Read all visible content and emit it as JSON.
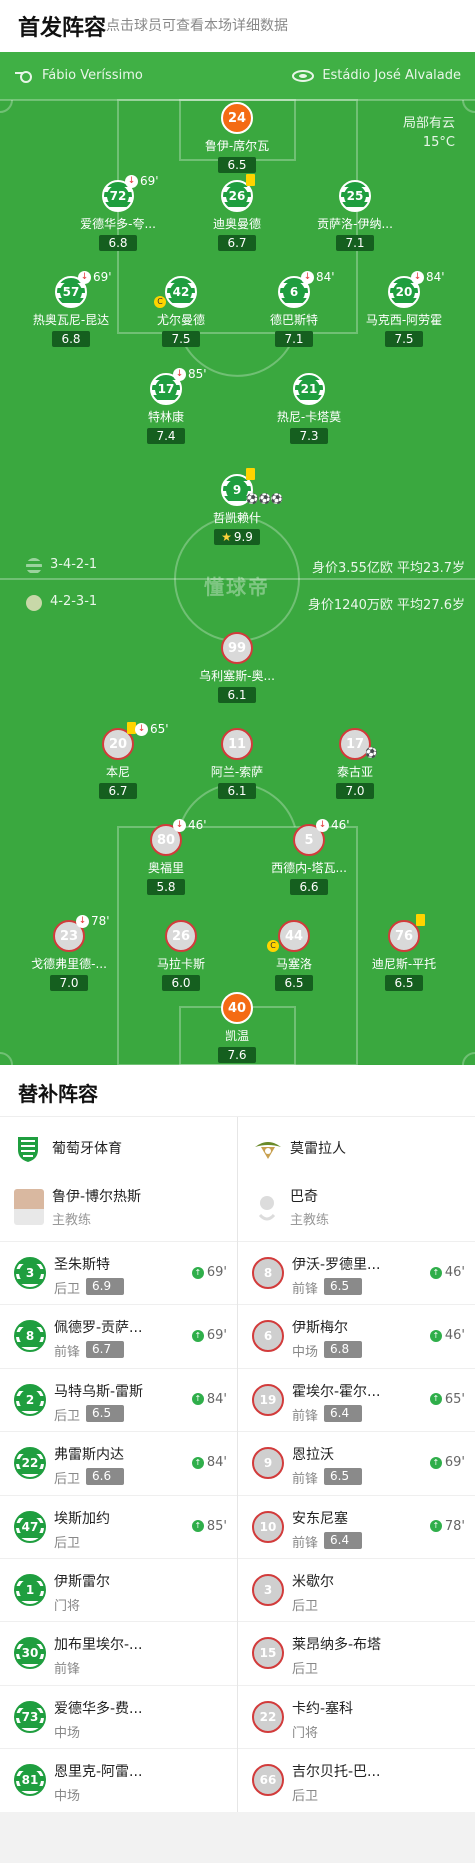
{
  "header": {
    "title": "首发阵容",
    "subtitle": "点击球员可查看本场详细数据"
  },
  "match": {
    "referee": "Fábio Veríssimo",
    "stadium": "Estádio José Alvalade",
    "weather": "局部有云",
    "temperature": "15°C"
  },
  "home_team": {
    "formation": "3-4-2-1",
    "value_avg": "身价3.55亿欧  平均23.7岁",
    "club": "葡萄牙体育",
    "coach_name": "鲁伊-博尔热斯",
    "coach_role": "主教练"
  },
  "away_team": {
    "formation": "4-2-3-1",
    "value_avg": "身价1240万欧  平均27.6岁",
    "club": "莫雷拉人",
    "coach_name": "巴奇",
    "coach_role": "主教练"
  },
  "watermark": "懂球帝",
  "home_players": [
    {
      "num": "24",
      "name": "鲁伊-席尔瓦",
      "rating": "6.5",
      "gk": true
    },
    {
      "num": "72",
      "name": "爱德华多-夸...",
      "rating": "6.8",
      "sub": "69'"
    },
    {
      "num": "26",
      "name": "迪奥曼德",
      "rating": "6.7",
      "yellow": true
    },
    {
      "num": "25",
      "name": "贡萨洛-伊纳...",
      "rating": "7.1"
    },
    {
      "num": "57",
      "name": "热奥瓦尼-昆达",
      "rating": "6.8",
      "sub": "69'"
    },
    {
      "num": "42",
      "name": "尤尔曼德",
      "rating": "7.5",
      "captain": "C"
    },
    {
      "num": "6",
      "name": "德巴斯特",
      "rating": "7.1",
      "sub": "84'"
    },
    {
      "num": "20",
      "name": "马克西-阿劳霍",
      "rating": "7.5",
      "sub": "84'"
    },
    {
      "num": "17",
      "name": "特林康",
      "rating": "7.4",
      "sub": "85'"
    },
    {
      "num": "21",
      "name": "热尼-卡塔莫",
      "rating": "7.3"
    },
    {
      "num": "9",
      "name": "哲凯赖什",
      "rating": "9.9",
      "yellow": true,
      "star": true,
      "goals": "⚽⚽⚽"
    }
  ],
  "away_players": [
    {
      "num": "99",
      "name": "乌利塞斯-奥...",
      "rating": "6.1"
    },
    {
      "num": "20",
      "name": "本尼",
      "rating": "6.7",
      "sub": "65'",
      "yellow": true
    },
    {
      "num": "11",
      "name": "阿兰-索萨",
      "rating": "6.1"
    },
    {
      "num": "17",
      "name": "泰古亚",
      "rating": "7.0",
      "goals": "⚽"
    },
    {
      "num": "80",
      "name": "奥福里",
      "rating": "5.8",
      "sub": "46'"
    },
    {
      "num": "5",
      "name": "西德内-塔瓦...",
      "rating": "6.6",
      "sub": "46'"
    },
    {
      "num": "23",
      "name": "戈德弗里德-...",
      "rating": "7.0",
      "sub": "78'"
    },
    {
      "num": "26",
      "name": "马拉卡斯",
      "rating": "6.0"
    },
    {
      "num": "44",
      "name": "马塞洛",
      "rating": "6.5",
      "captain": "C"
    },
    {
      "num": "76",
      "name": "迪尼斯-平托",
      "rating": "6.5",
      "yellow": true
    },
    {
      "num": "40",
      "name": "凯温",
      "rating": "7.6",
      "gk": true
    }
  ],
  "subs_title": "替补阵容",
  "home_subs": [
    {
      "num": "3",
      "name": "圣朱斯特",
      "pos": "后卫",
      "rating": "6.9",
      "min": "69'"
    },
    {
      "num": "8",
      "name": "佩德罗-贡萨...",
      "pos": "前锋",
      "rating": "6.7",
      "min": "69'"
    },
    {
      "num": "2",
      "name": "马特乌斯-雷斯",
      "pos": "后卫",
      "rating": "6.5",
      "min": "84'"
    },
    {
      "num": "22",
      "name": "弗雷斯内达",
      "pos": "后卫",
      "rating": "6.6",
      "min": "84'"
    },
    {
      "num": "47",
      "name": "埃斯加约",
      "pos": "后卫",
      "rating": "",
      "min": "85'"
    },
    {
      "num": "1",
      "name": "伊斯雷尔",
      "pos": "门将",
      "rating": "",
      "min": ""
    },
    {
      "num": "30",
      "name": "加布里埃尔-...",
      "pos": "前锋",
      "rating": "",
      "min": ""
    },
    {
      "num": "73",
      "name": "爱德华多-费...",
      "pos": "中场",
      "rating": "",
      "min": ""
    },
    {
      "num": "81",
      "name": "恩里克-阿雷...",
      "pos": "中场",
      "rating": "",
      "min": ""
    }
  ],
  "away_subs": [
    {
      "num": "8",
      "name": "伊沃-罗德里...",
      "pos": "前锋",
      "rating": "6.5",
      "min": "46'"
    },
    {
      "num": "6",
      "name": "伊斯梅尔",
      "pos": "中场",
      "rating": "6.8",
      "min": "46'"
    },
    {
      "num": "19",
      "name": "霍埃尔-霍尔...",
      "pos": "前锋",
      "rating": "6.4",
      "min": "65'"
    },
    {
      "num": "9",
      "name": "恩拉沃",
      "pos": "前锋",
      "rating": "6.5",
      "min": "69'"
    },
    {
      "num": "10",
      "name": "安东尼塞",
      "pos": "前锋",
      "rating": "6.4",
      "min": "78'"
    },
    {
      "num": "3",
      "name": "米歇尔",
      "pos": "后卫",
      "rating": "",
      "min": ""
    },
    {
      "num": "15",
      "name": "莱昂纳多-布塔",
      "pos": "后卫",
      "rating": "",
      "min": ""
    },
    {
      "num": "22",
      "name": "卡约-塞科",
      "pos": "门将",
      "rating": "",
      "min": ""
    },
    {
      "num": "66",
      "name": "吉尔贝托-巴...",
      "pos": "后卫",
      "rating": "",
      "min": ""
    }
  ],
  "colors": {
    "pitch": "#3aa83f",
    "home_green": "#1f9e3f",
    "away_red": "#d23b3b",
    "gk_orange": "#f46b14"
  }
}
